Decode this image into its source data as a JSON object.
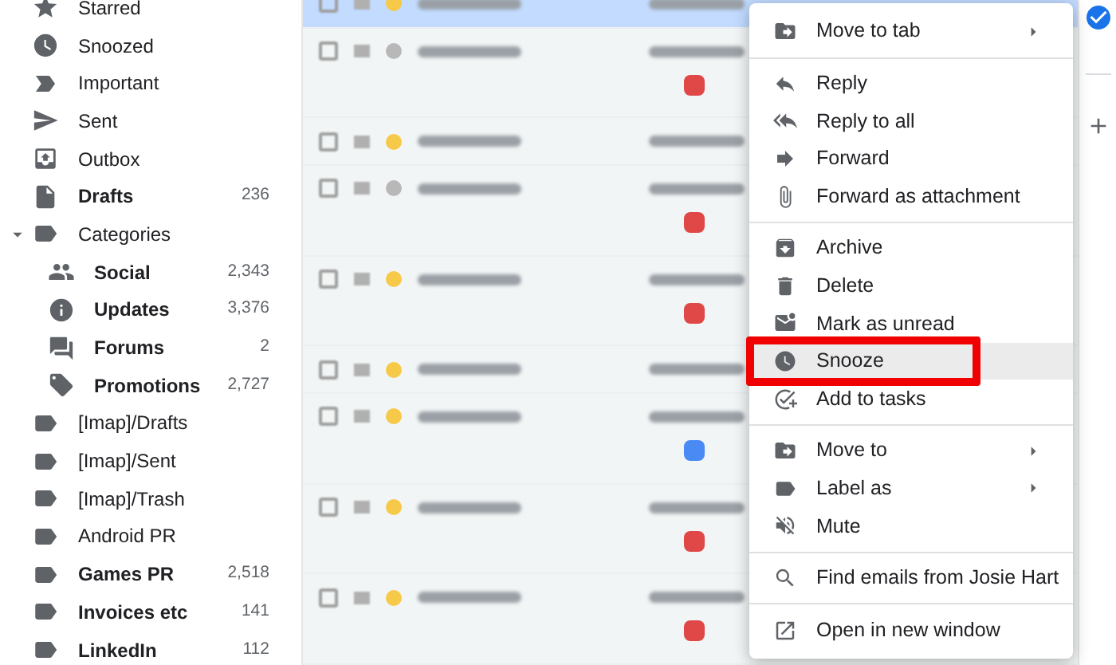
{
  "sidebar": {
    "items": [
      {
        "label": "Starred",
        "bold": false
      },
      {
        "label": "Snoozed",
        "bold": false
      },
      {
        "label": "Important",
        "bold": false
      },
      {
        "label": "Sent",
        "bold": false
      },
      {
        "label": "Outbox",
        "bold": false
      },
      {
        "label": "Drafts",
        "count": "236",
        "bold": true
      },
      {
        "label": "Categories",
        "bold": false,
        "expanded": true,
        "children": [
          {
            "label": "Social",
            "count": "2,343",
            "bold": true
          },
          {
            "label": "Updates",
            "count": "3,376",
            "bold": true
          },
          {
            "label": "Forums",
            "count": "2",
            "bold": true
          },
          {
            "label": "Promotions",
            "count": "2,727",
            "bold": true
          }
        ]
      },
      {
        "label": "[Imap]/Drafts",
        "bold": false
      },
      {
        "label": "[Imap]/Sent",
        "bold": false
      },
      {
        "label": "[Imap]/Trash",
        "bold": false
      },
      {
        "label": "Android PR",
        "bold": false
      },
      {
        "label": "Games PR",
        "count": "2,518",
        "bold": true
      },
      {
        "label": "Invoices etc",
        "count": "141",
        "bold": true
      },
      {
        "label": "LinkedIn",
        "count": "112",
        "bold": true
      }
    ]
  },
  "email_list": {
    "rows": [
      {
        "selected": true,
        "starred": true
      },
      {
        "selected": false,
        "starred": false,
        "color": "#e04848"
      },
      {
        "selected": false,
        "starred": true
      },
      {
        "selected": false,
        "starred": false,
        "color": "#e04848"
      },
      {
        "selected": false,
        "starred": true,
        "color": "#e04848"
      },
      {
        "selected": false,
        "starred": true
      },
      {
        "selected": false,
        "starred": true,
        "color": "#4a8af4"
      },
      {
        "selected": false,
        "starred": true,
        "color": "#e04848"
      },
      {
        "selected": false,
        "starred": true,
        "color": "#e04848"
      }
    ]
  },
  "context_menu": {
    "groups": [
      [
        {
          "label": "Move to tab",
          "submenu": true,
          "selected": false,
          "annotated": false
        }
      ],
      [
        {
          "label": "Reply",
          "submenu": false,
          "selected": false,
          "annotated": false
        },
        {
          "label": "Reply to all",
          "submenu": false,
          "selected": false,
          "annotated": false
        },
        {
          "label": "Forward",
          "submenu": false,
          "selected": false,
          "annotated": false
        },
        {
          "label": "Forward as attachment",
          "submenu": false,
          "selected": false,
          "annotated": false
        }
      ],
      [
        {
          "label": "Archive",
          "submenu": false,
          "selected": false,
          "annotated": false
        },
        {
          "label": "Delete",
          "submenu": false,
          "selected": false,
          "annotated": false
        },
        {
          "label": "Mark as unread",
          "submenu": false,
          "selected": false,
          "annotated": false
        },
        {
          "label": "Snooze",
          "submenu": false,
          "selected": true,
          "annotated": true
        },
        {
          "label": "Add to tasks",
          "submenu": false,
          "selected": false,
          "annotated": false
        }
      ],
      [
        {
          "label": "Move to",
          "submenu": true,
          "selected": false,
          "annotated": false
        },
        {
          "label": "Label as",
          "submenu": true,
          "selected": false,
          "annotated": false
        },
        {
          "label": "Mute",
          "submenu": false,
          "selected": false,
          "annotated": false
        }
      ],
      [
        {
          "label": "Find emails from Josie Hart",
          "submenu": false,
          "selected": false,
          "annotated": false
        }
      ],
      [
        {
          "label": "Open in new window",
          "submenu": false,
          "selected": false,
          "annotated": false
        }
      ]
    ]
  }
}
